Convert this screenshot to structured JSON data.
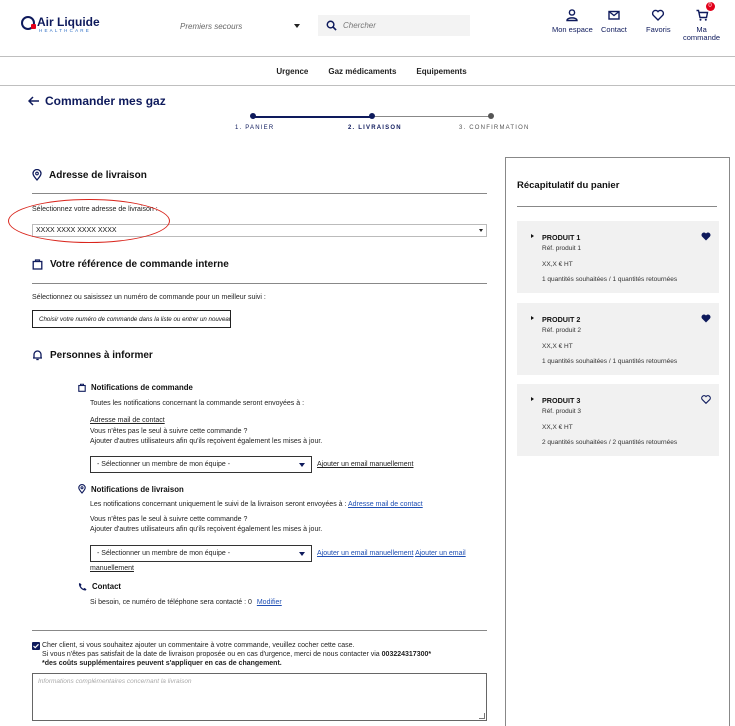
{
  "header": {
    "logo_name": "Air Liquide",
    "logo_sub": "HEALTHCARE",
    "category_select": "Premiers secours",
    "search_placeholder": "Chercher",
    "buttons": [
      {
        "label": "Mon espace",
        "icon": "user-icon"
      },
      {
        "label": "Contact",
        "icon": "mail-icon"
      },
      {
        "label": "Favoris",
        "icon": "heart-icon"
      },
      {
        "label_line1": "Ma",
        "label_line2": "commande",
        "icon": "cart-icon",
        "badge": "0"
      }
    ]
  },
  "nav": [
    "Urgence",
    "Gaz médicaments",
    "Equipements"
  ],
  "page_title": "Commander mes gaz",
  "stepper": [
    {
      "label": "1. PANIER",
      "state": "done"
    },
    {
      "label": "2. LIVRAISON",
      "state": "current"
    },
    {
      "label": "3. CONFIRMATION",
      "state": "todo"
    }
  ],
  "delivery_address": {
    "title": "Adresse de livraison",
    "label": "Sélectionnez votre adresse de livraison :",
    "value": "XXXX XXXX XXXX XXXX"
  },
  "internal_reference": {
    "title": "Votre référence de commande interne",
    "hint": "Sélectionnez ou saisissez un numéro de commande pour un meilleur suivi :",
    "placeholder": "Choisir votre numéro de commande dans la liste ou entrer un nouveau"
  },
  "people": {
    "title": "Personnes à informer",
    "order_notifications": {
      "title": "Notifications de commande",
      "text": "Toutes les notifications concernant la commande seront envoyées à :",
      "email_link": "Adresse mail de contact",
      "not_alone": "Vous n'êtes pas le seul à suivre cette commande ?",
      "add_users": "Ajouter d'autres utilisateurs afin qu'ils reçoivent également les mises à jour.",
      "member_select": "- Sélectionner un membre de mon équipe -",
      "add_email_link": "Ajouter un email manuellement"
    },
    "delivery_notifications": {
      "title": "Notifications de livraison",
      "text": "Les notifications concernant uniquement le suivi de la livraison seront envoyées à :",
      "email_link": "Adresse mail de contact",
      "not_alone": "Vous n'êtes pas le seul à suivre cette commande ?",
      "add_users": "Ajouter d'autres utilisateurs afin qu'ils reçoivent également les mises à jour.",
      "member_select": "- Sélectionner un membre de mon équipe -",
      "add_email_link_1": "Ajouter un email manuellement",
      "add_email_link_2a": "Ajouter un email",
      "add_email_link_2b": "manuellement"
    },
    "contact": {
      "title": "Contact",
      "text": "Si besoin, ce numéro de téléphone sera contacté : 0",
      "modify_link": "Modifier"
    }
  },
  "comment": {
    "line1": "Cher client, si vous souhaitez ajouter un commentaire à votre commande, veuillez cocher cette case.",
    "line2_prefix": "Si vous n'êtes pas satisfait de la date de livraison proposée ou en cas d'urgence, merci de nous contacter via ",
    "phone": "003224317300*",
    "line3": "*des coûts supplémentaires peuvent s'appliquer en cas de changement.",
    "placeholder": "Informations complémentaires concernant la livraison",
    "checked": true
  },
  "summary": {
    "title": "Récapitulatif du panier",
    "products": [
      {
        "name": "PRODUIT 1",
        "ref": "Réf. produit 1",
        "price": "XX,X € HT",
        "qty": "1 quantités souhaitées / 1 quantités retournées",
        "favorite": true
      },
      {
        "name": "PRODUIT 2",
        "ref": "Réf. produit 2",
        "price": "XX,X € HT",
        "qty": "1 quantités souhaitées / 1 quantités retournées",
        "favorite": true
      },
      {
        "name": "PRODUIT 3",
        "ref": "Réf. produit 3",
        "price": "XX,X € HT",
        "qty": "2 quantités souhaitées / 2 quantités retournées",
        "favorite": false
      }
    ]
  },
  "colors": {
    "brand_navy": "#0e1a5c",
    "brand_red": "#e2001a",
    "link": "#1f4fb3",
    "card_bg": "#f1f1f1"
  }
}
